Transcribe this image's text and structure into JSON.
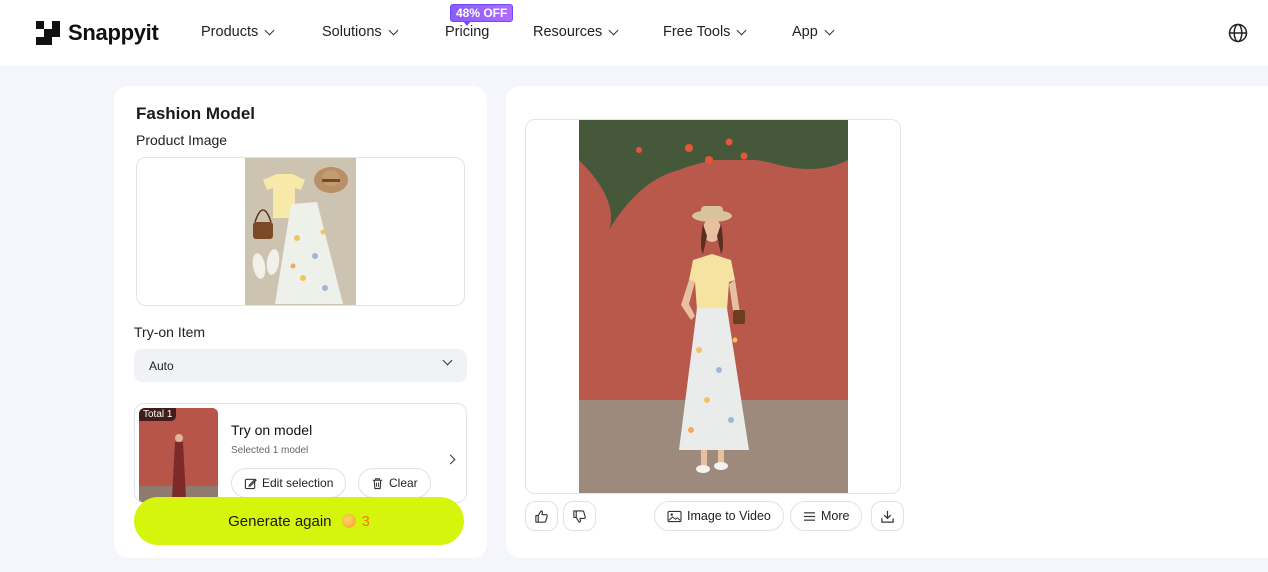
{
  "nav": {
    "brand": "Snappyit",
    "items": [
      {
        "label": "Products",
        "has_dropdown": true
      },
      {
        "label": "Solutions",
        "has_dropdown": true
      },
      {
        "label": "Pricing",
        "has_dropdown": false
      },
      {
        "label": "Resources",
        "has_dropdown": true
      },
      {
        "label": "Free Tools",
        "has_dropdown": true
      },
      {
        "label": "App",
        "has_dropdown": true
      }
    ],
    "pricing_badge": "48% OFF",
    "language_icon": "globe-icon"
  },
  "left_panel": {
    "title": "Fashion Model",
    "product_image_label": "Product Image",
    "tryon_label": "Try-on Item",
    "tryon_selected": "Auto",
    "model_card": {
      "tag": "Total 1",
      "title": "Try on model",
      "subtitle": "Selected 1 model",
      "edit_label": "Edit selection",
      "clear_label": "Clear"
    },
    "generate_label": "Generate again",
    "credit_cost": "3"
  },
  "right_panel": {
    "actions": {
      "image_to_video": "Image to Video",
      "more": "More"
    }
  },
  "colors": {
    "accent": "#d6f50d",
    "badge": "#8a5cff",
    "credit": "#f07a1a",
    "background": "#f4f6fb"
  }
}
